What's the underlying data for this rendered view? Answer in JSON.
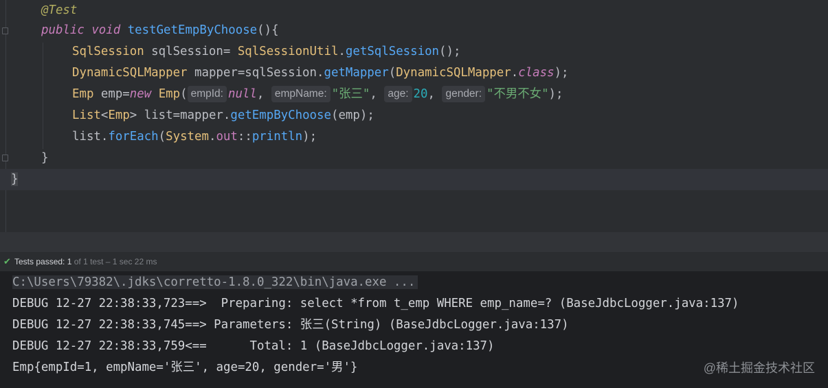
{
  "editor": {
    "lines": {
      "l1": {
        "annotation": "@Test"
      },
      "l2": {
        "kw_public": "public",
        "kw_void": "void",
        "method": "testGetEmpByChoose",
        "tail": "(){"
      },
      "l3": {
        "type1": "SqlSession",
        "mid": " sqlSession= ",
        "type2": "SqlSessionUtil",
        "dot": ".",
        "fn": "getSqlSession",
        "tail": "();"
      },
      "l4": {
        "type1": "DynamicSQLMapper",
        "mid": " mapper=sqlSession.",
        "fn": "getMapper",
        "paren": "(",
        "type2": "DynamicSQLMapper",
        "dot": ".",
        "kw": "class",
        "tail": ");"
      },
      "l5": {
        "type1": "Emp",
        "mid": " emp=",
        "kw_new": "new",
        "space": " ",
        "type2": "Emp",
        "paren": "(",
        "hint1": "empId:",
        "null": "null",
        "comma1": ",",
        "hint2": "empName:",
        "str1": "\"张三\"",
        "comma2": ",",
        "hint3": "age:",
        "num": "20",
        "comma3": ",",
        "hint4": "gender:",
        "str2": "\"不男不女\"",
        "tail": ");"
      },
      "l6": {
        "type1": "List",
        "lt": "<",
        "type2": "Emp",
        "mid": "> list=mapper.",
        "fn": "getEmpByChoose",
        "tail": "(emp);"
      },
      "l7": {
        "pre": "list.",
        "fn": "forEach",
        "paren": "(",
        "cls": "System",
        "dot": ".",
        "fld": "out",
        "sep": "::",
        "fn2": "println",
        "tail": ");"
      },
      "l8": {
        "brace": "}"
      },
      "l9": {
        "brace": "}"
      }
    }
  },
  "status": {
    "passed_label": "Tests passed: 1",
    "of_label": "of 1 test – 1 sec 22 ms"
  },
  "console": {
    "cmd": "C:\\Users\\79382\\.jdks\\corretto-1.8.0_322\\bin\\java.exe ...",
    "lines": [
      "DEBUG 12-27 22:38:33,723==>  Preparing: select *from t_emp WHERE emp_name=? (BaseJdbcLogger.java:137)",
      "DEBUG 12-27 22:38:33,745==> Parameters: 张三(String) (BaseJdbcLogger.java:137)",
      "DEBUG 12-27 22:38:33,759<==      Total: 1 (BaseJdbcLogger.java:137)",
      "Emp{empId=1, empName='张三', age=20, gender='男'}"
    ]
  },
  "watermark": "@稀土掘金技术社区",
  "icons": {
    "status_icon": "check-icon"
  }
}
